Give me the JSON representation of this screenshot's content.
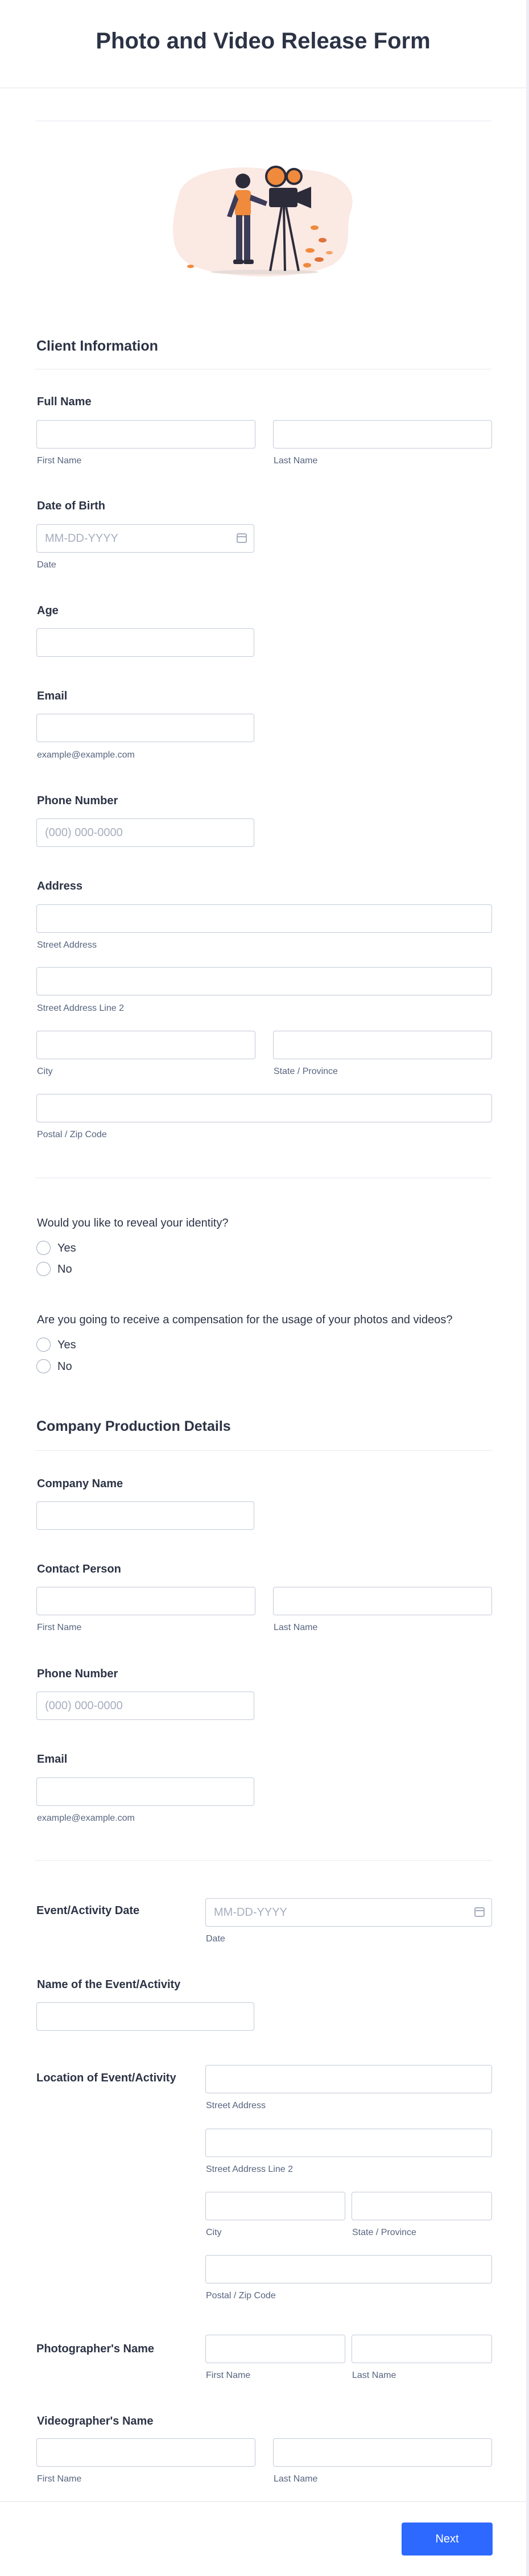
{
  "form": {
    "title": "Photo and Video Release Form"
  },
  "client": {
    "section_title": "Client Information",
    "full_name_label": "Full Name",
    "first_name_sub": "First Name",
    "last_name_sub": "Last Name",
    "dob_label": "Date of Birth",
    "dob_placeholder": "MM-DD-YYYY",
    "dob_sub": "Date",
    "age_label": "Age",
    "email_label": "Email",
    "email_sub": "example@example.com",
    "phone_label": "Phone Number",
    "phone_placeholder": "(000) 000-0000",
    "address_label": "Address",
    "street_sub": "Street Address",
    "street2_sub": "Street Address Line 2",
    "city_sub": "City",
    "state_sub": "State / Province",
    "zip_sub": "Postal / Zip Code"
  },
  "questions": {
    "reveal_label": "Would you like to reveal your identity?",
    "compensation_label": "Are you going to receive a compensation for the usage of your photos and videos?",
    "yes": "Yes",
    "no": "No"
  },
  "company": {
    "section_title": "Company Production Details",
    "company_name_label": "Company Name",
    "contact_label": "Contact Person",
    "first_name_sub": "First Name",
    "last_name_sub": "Last Name",
    "phone_label": "Phone Number",
    "phone_placeholder": "(000) 000-0000",
    "email_label": "Email",
    "email_sub": "example@example.com"
  },
  "event": {
    "date_label": "Event/Activity Date",
    "date_placeholder": "MM-DD-YYYY",
    "date_sub": "Date",
    "name_label": "Name of the Event/Activity",
    "location_label": "Location of Event/Activity",
    "street_sub": "Street Address",
    "street2_sub": "Street Address Line 2",
    "city_sub": "City",
    "state_sub": "State / Province",
    "zip_sub": "Postal / Zip Code",
    "photographer_label": "Photographer's Name",
    "videographer_label": "Videographer's Name",
    "first_name_sub": "First Name",
    "last_name_sub": "Last Name"
  },
  "footer": {
    "next_label": "Next"
  },
  "icons": {
    "date_picker": "calendar-icon",
    "illustration": "camera-operator-illustration"
  },
  "colors": {
    "accent": "#2e69ff",
    "illustration_orange": "#f08a3c",
    "illustration_blush": "#fbe9e4"
  }
}
